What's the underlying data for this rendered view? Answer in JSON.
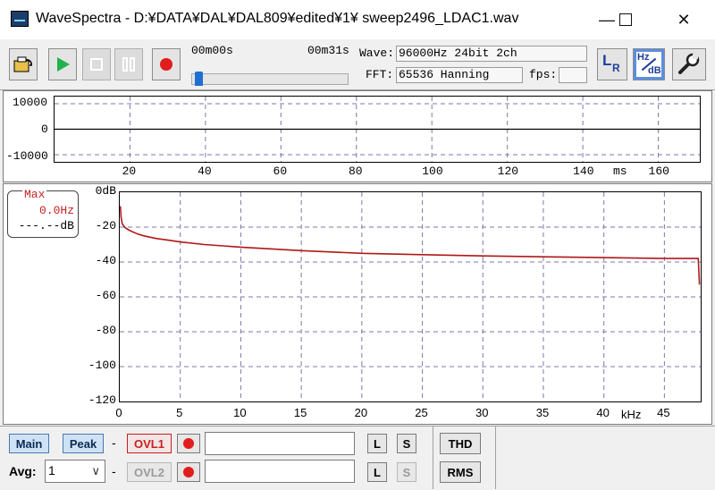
{
  "window": {
    "title": "WaveSpectra - D:¥DATA¥DAL¥DAL809¥edited¥1¥ sweep2496_LDAC1.wav",
    "minimize_glyph": "—",
    "maximize_glyph": "☐",
    "close_glyph": "✕"
  },
  "toolbar": {
    "icons": {
      "open": "folder-open-icon",
      "play": "play-icon",
      "stop": "stop-icon",
      "pause": "pause-icon",
      "record": "record-icon",
      "lr": "lr-channel-icon",
      "hzdb": "hz-db-scale-icon",
      "settings": "wrench-icon"
    },
    "time_start": "00m00s",
    "time_end": "00m31s",
    "position_fraction": 0.02,
    "wave_label": "Wave:",
    "wave_value": "96000Hz 24bit 2ch",
    "fft_label": "FFT:",
    "fft_value": "65536 Hanning",
    "fps_label": "fps:",
    "fps_value": "",
    "lr_text_l": "L",
    "lr_text_r": "R",
    "hzdb_text_hz": "Hz",
    "hzdb_text_db": "dB"
  },
  "waveform": {
    "y_ticks": [
      "10000",
      "0",
      "-10000"
    ],
    "x_ticks": [
      "20",
      "40",
      "60",
      "80",
      "100",
      "120",
      "140",
      "160"
    ],
    "x_unit": "ms"
  },
  "spectrum": {
    "max_label": "Max",
    "max_freq": "0.0Hz",
    "max_db": "---.--dB",
    "y_ticks": [
      "0dB",
      "-20",
      "-40",
      "-60",
      "-80",
      "-100",
      "-120"
    ],
    "x_ticks": [
      "0",
      "5",
      "10",
      "15",
      "20",
      "25",
      "30",
      "35",
      "40",
      "45"
    ],
    "x_unit": "kHz",
    "line_color": "#b01818"
  },
  "chart_data": {
    "type": "line",
    "xlabel": "kHz",
    "ylabel": "",
    "xlim": [
      0,
      48
    ],
    "ylim": [
      -120,
      0
    ],
    "grid": true,
    "series": [
      {
        "x": [
          0.05,
          0.1,
          0.2,
          0.4,
          0.7,
          1,
          1.5,
          2,
          3,
          4,
          5,
          7,
          10,
          15,
          20,
          25,
          30,
          35,
          40,
          45,
          47.8,
          47.9
        ],
        "y": [
          -8,
          -14,
          -18,
          -20,
          -21.5,
          -22.5,
          -24,
          -25,
          -26.5,
          -27.5,
          -28.5,
          -30,
          -31.5,
          -33.5,
          -35,
          -35.8,
          -36.5,
          -37,
          -37.5,
          -38,
          -38,
          -53
        ]
      }
    ]
  },
  "bottom": {
    "main_label": "Main",
    "peak_label": "Peak",
    "dash": "-",
    "ovl1_label": "OVL1",
    "ovl2_label": "OVL2",
    "l_label": "L",
    "s_label": "S",
    "thd_label": "THD",
    "rms_label": "RMS",
    "avg_label": "Avg:",
    "avg_value": "1",
    "avg_arrow": "∨"
  }
}
